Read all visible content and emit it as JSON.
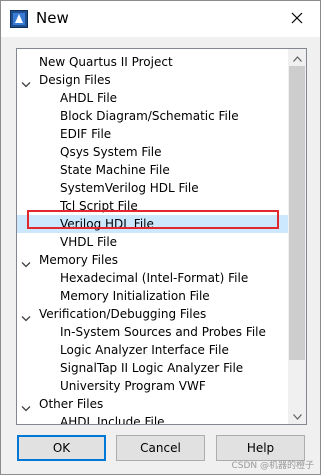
{
  "window": {
    "title": "New"
  },
  "tree": {
    "items": [
      {
        "label": "New Quartus II Project",
        "level": 0,
        "expandable": false
      },
      {
        "label": "Design Files",
        "level": 0,
        "expandable": true
      },
      {
        "label": "AHDL File",
        "level": 1
      },
      {
        "label": "Block Diagram/Schematic File",
        "level": 1
      },
      {
        "label": "EDIF File",
        "level": 1
      },
      {
        "label": "Qsys System File",
        "level": 1
      },
      {
        "label": "State Machine File",
        "level": 1
      },
      {
        "label": "SystemVerilog HDL File",
        "level": 1
      },
      {
        "label": "Tcl Script File",
        "level": 1
      },
      {
        "label": "Verilog HDL File",
        "level": 1,
        "selected": true
      },
      {
        "label": "VHDL File",
        "level": 1
      },
      {
        "label": "Memory Files",
        "level": 0,
        "expandable": true
      },
      {
        "label": "Hexadecimal (Intel-Format) File",
        "level": 1
      },
      {
        "label": "Memory Initialization File",
        "level": 1
      },
      {
        "label": "Verification/Debugging Files",
        "level": 0,
        "expandable": true
      },
      {
        "label": "In-System Sources and Probes File",
        "level": 1
      },
      {
        "label": "Logic Analyzer Interface File",
        "level": 1
      },
      {
        "label": "SignalTap II Logic Analyzer File",
        "level": 1
      },
      {
        "label": "University Program VWF",
        "level": 1
      },
      {
        "label": "Other Files",
        "level": 0,
        "expandable": true
      },
      {
        "label": "AHDL Include File",
        "level": 1
      }
    ]
  },
  "buttons": {
    "ok": "OK",
    "cancel": "Cancel",
    "help": "Help"
  },
  "watermark": "CSDN @机器的橙子",
  "colors": {
    "highlight": "#e0282e",
    "selection": "#cce8ff",
    "accent": "#0078d7"
  },
  "icons": {
    "app": "quartus-app-icon",
    "close": "close-icon",
    "expand": "chevron-down-icon"
  }
}
